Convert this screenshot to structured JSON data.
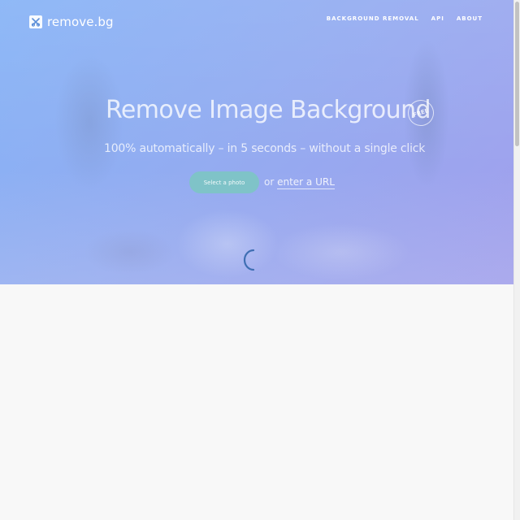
{
  "header": {
    "brand": "remove.bg",
    "logo_icon": "scissors-icon",
    "nav": [
      {
        "label": "BACKGROUND REMOVAL"
      },
      {
        "label": "API"
      },
      {
        "label": "ABOUT"
      }
    ]
  },
  "hero": {
    "headline": "Remove Image Background",
    "badge": "FREE",
    "subline": "100% automatically – in 5 seconds – without a single click",
    "select_button": "Select a photo",
    "or_text": "or",
    "url_link": "enter a URL",
    "loading_icon": "spinner-icon"
  },
  "colors": {
    "hero_start": "#86b3f6",
    "hero_end": "#a29fec",
    "button": "#7fc3c8",
    "spinner": "#3f6fb3",
    "page_bg": "#f8f8f8"
  }
}
